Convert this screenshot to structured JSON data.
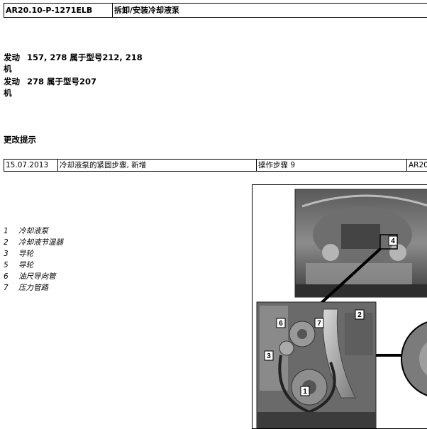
{
  "header": {
    "doc_id": "AR20.10-P-1271ELB",
    "title": "拆卸/安装冷却液泵"
  },
  "engines": [
    {
      "label": "发动机",
      "value": "157, 278 属于型号212, 218"
    },
    {
      "label": "发动机",
      "value": "278 属于型号207"
    }
  ],
  "changes": {
    "title": "更改提示",
    "row": {
      "date": "15.07.2013",
      "description": "冷却液泵的紧固步骤, 新增",
      "step": "操作步骤 9",
      "ref": "AR20"
    }
  },
  "legend": [
    {
      "num": "1",
      "text": "冷却液泵"
    },
    {
      "num": "2",
      "text": "冷却液节温器"
    },
    {
      "num": "3",
      "text": "导轮"
    },
    {
      "num": "5",
      "text": "导轮"
    },
    {
      "num": "6",
      "text": "油尺导向管"
    },
    {
      "num": "7",
      "text": "压力管路"
    }
  ],
  "figure": {
    "callouts": [
      "4",
      "6",
      "7",
      "2",
      "3",
      "1"
    ]
  }
}
